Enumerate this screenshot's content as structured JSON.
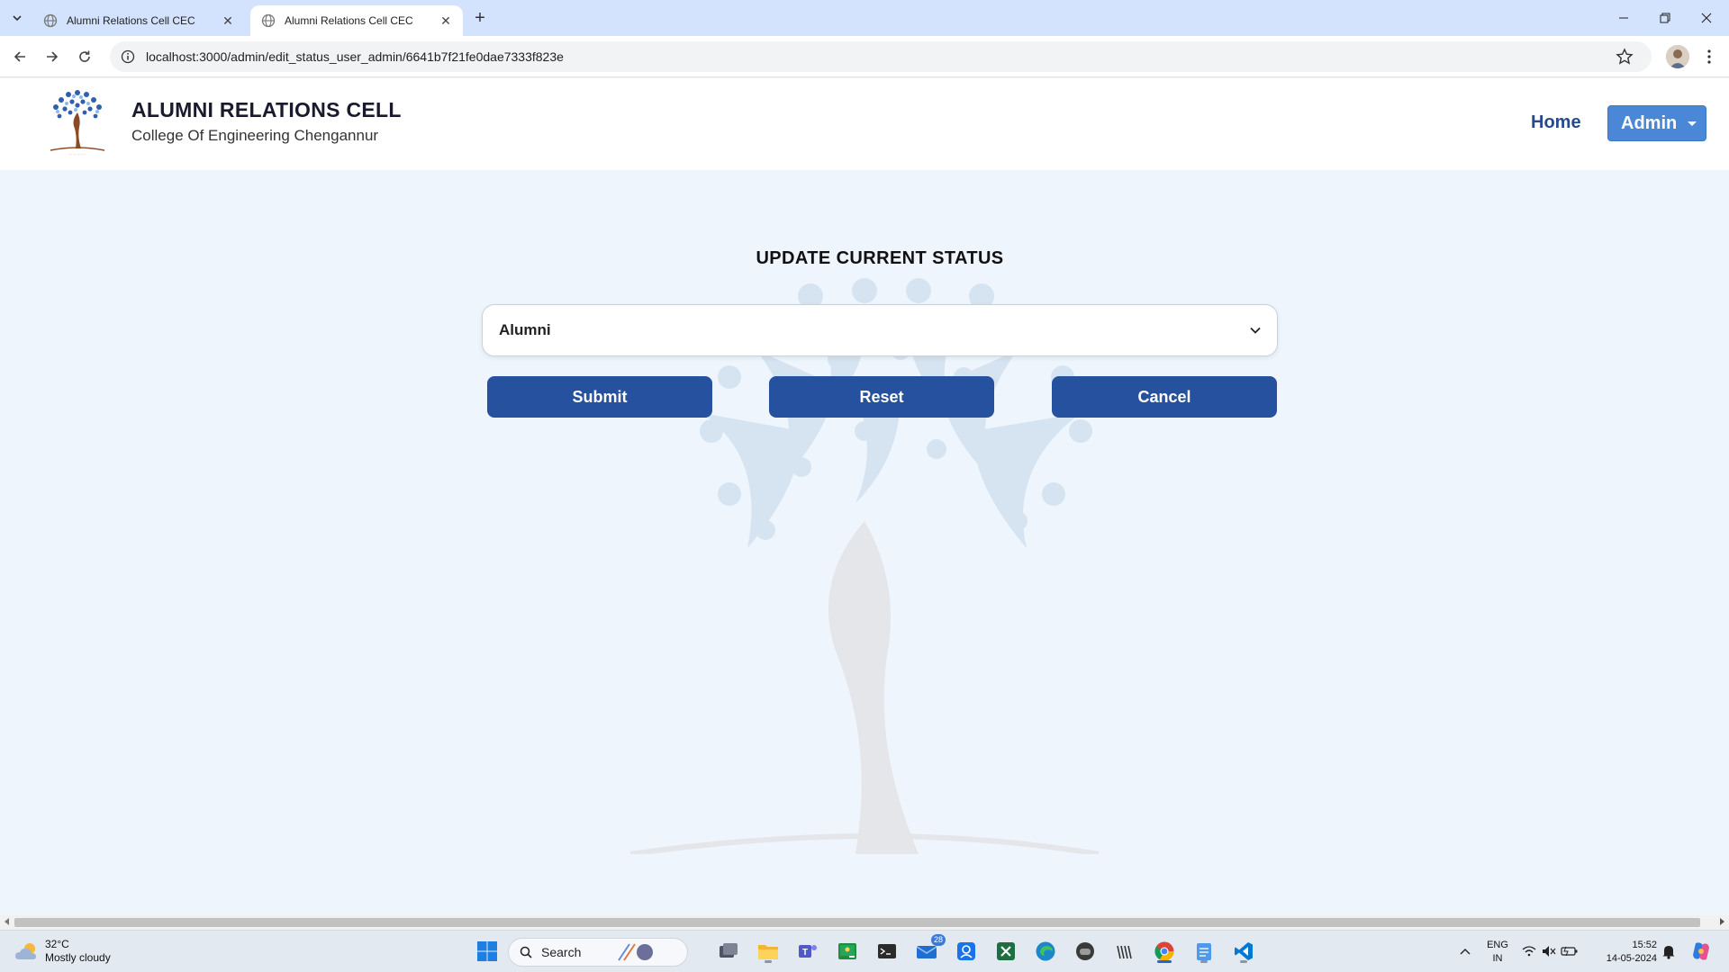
{
  "browser": {
    "tabs": [
      {
        "title": "Alumni Relations Cell CEC",
        "active": false
      },
      {
        "title": "Alumni Relations Cell CEC",
        "active": true
      }
    ],
    "url": "localhost:3000/admin/edit_status_user_admin/6641b7f21fe0dae7333f823e"
  },
  "header": {
    "title": "ALUMNI RELATIONS CELL",
    "subtitle": "College Of Engineering Chengannur",
    "nav": {
      "home_label": "Home",
      "admin_label": "Admin"
    }
  },
  "form": {
    "title": "UPDATE CURRENT STATUS",
    "status_select": {
      "selected": "Alumni"
    },
    "buttons": {
      "submit": "Submit",
      "reset": "Reset",
      "cancel": "Cancel"
    }
  },
  "colors": {
    "primary_button": "#26519f",
    "admin_button": "#4a87d6",
    "nav_link": "#274a8f",
    "page_background": "#eef5fd"
  },
  "taskbar": {
    "weather": {
      "temperature": "32°C",
      "condition": "Mostly cloudy"
    },
    "search_label": "Search",
    "mail_badge": "28",
    "language": {
      "line1": "ENG",
      "line2": "IN"
    },
    "clock": {
      "time": "15:52",
      "date": "14-05-2024"
    }
  }
}
